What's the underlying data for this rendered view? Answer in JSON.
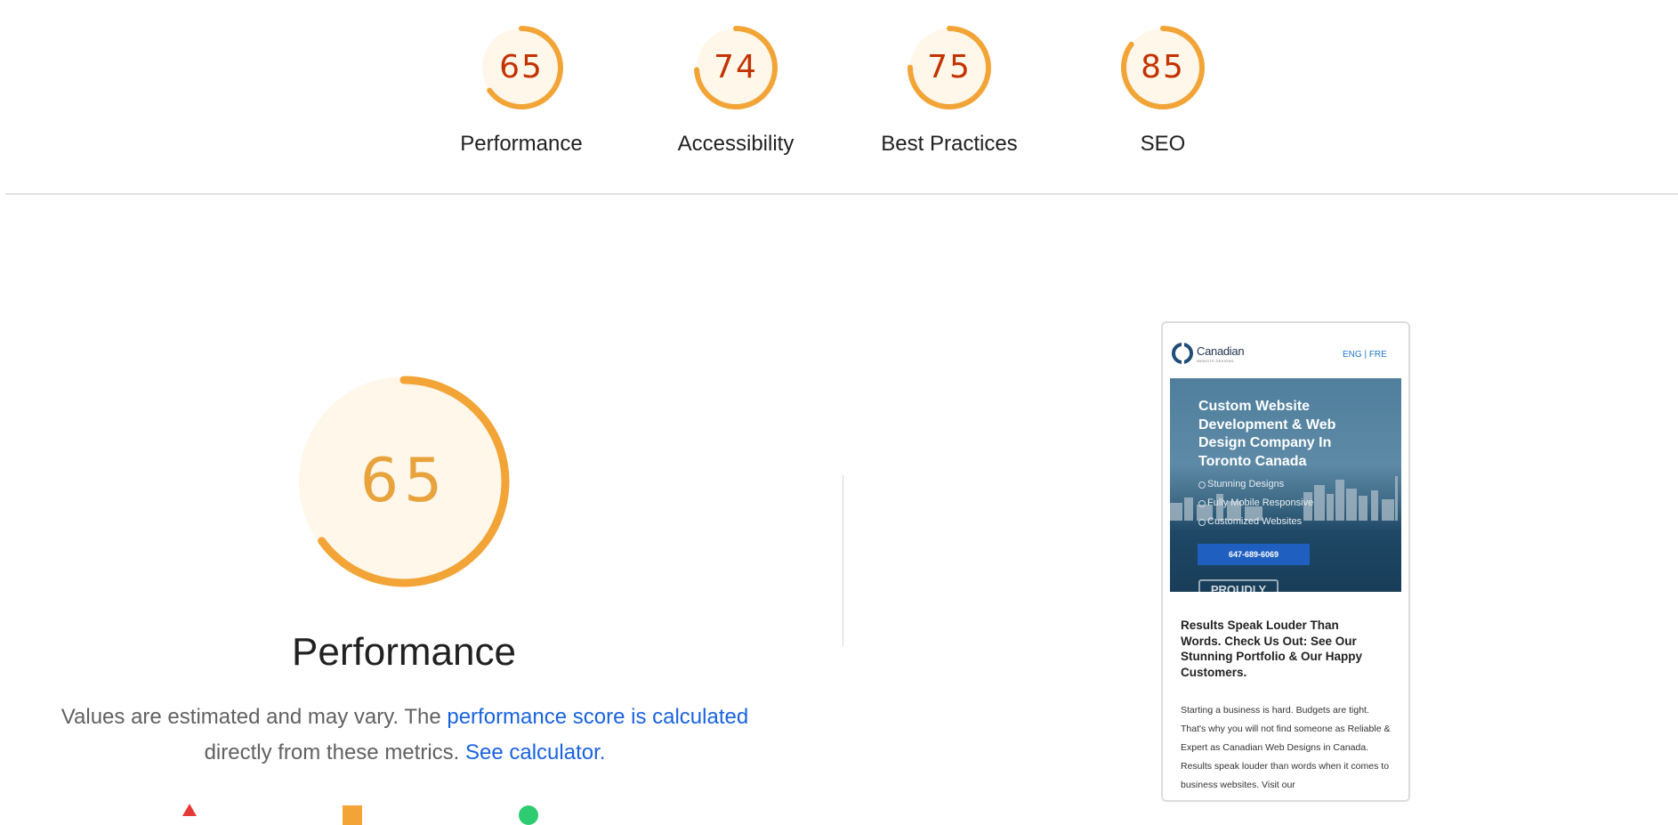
{
  "categories": [
    {
      "id": "performance",
      "score": 65,
      "label": "Performance"
    },
    {
      "id": "accessibility",
      "score": 74,
      "label": "Accessibility"
    },
    {
      "id": "best-practices",
      "score": 75,
      "label": "Best Practices"
    },
    {
      "id": "seo",
      "score": 85,
      "label": "SEO"
    }
  ],
  "performance": {
    "score": 65,
    "title": "Performance",
    "desc_prefix": "Values are estimated and may vary. The",
    "desc_link": "performance score is calculated",
    "desc_middle": "directly from these metrics.",
    "calculator_link": "See calculator."
  },
  "colors": {
    "average": "#f2a436",
    "average_text": "#c33300",
    "average_bg": "#fff7ea",
    "link": "#1a63e0"
  },
  "screenshot": {
    "logo_text": "Canadian",
    "logo_sub": "WEBSITE DESIGNS",
    "lang": "ENG | FRE",
    "hero_title": "Custom Website Development & Web Design Company In Toronto Canada",
    "bullets": [
      "Stunning Designs",
      "Fully Mobile Responsive",
      "Customized Websites"
    ],
    "cta": "647-689-6069",
    "badge": "PROUDLY CANADIAN",
    "results_heading": "Results Speak Louder Than Words. Check Us Out: See Our Stunning Portfolio & Our Happy Customers.",
    "body": "Starting a business is hard. Budgets are tight. That's why you will not find someone as Reliable & Expert as Canadian Web Designs in Canada. Results speak louder than words when it comes to business websites. Visit our"
  }
}
